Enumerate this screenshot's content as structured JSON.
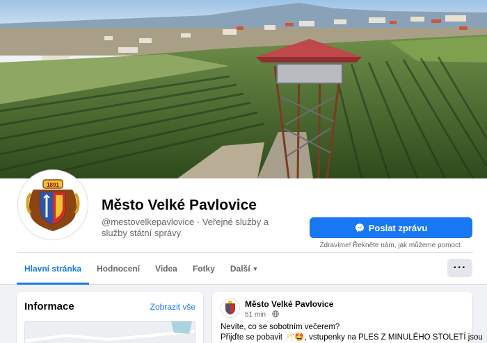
{
  "page": {
    "name": "Město Velké Pavlovice",
    "handle_category": "@mestovelkepavlovice · Veřejné služby a služby státní správy",
    "crest_year": "1891"
  },
  "actions": {
    "message_button": "Poslat zprávu",
    "message_hint": "Zdravíme! Řekněte nám, jak můžeme pomoct.",
    "more_icon": "ellipsis-icon"
  },
  "tabs": [
    {
      "label": "Hlavní stránka",
      "active": true
    },
    {
      "label": "Hodnocení"
    },
    {
      "label": "Videa"
    },
    {
      "label": "Fotky"
    },
    {
      "label": "Další",
      "caret": "▾"
    }
  ],
  "info": {
    "title": "Informace",
    "see_all": "Zobrazit vše"
  },
  "post": {
    "author": "Město Velké Pavlovice",
    "time": "51 min",
    "audience_icon": "globe-icon",
    "line1": "Nevíte, co se sobotním večerem?",
    "line2": "Přijďte se pobavit 🥂🤩, vstupenky na PLES Z MINULÉHO STOLETÍ jsou"
  },
  "colors": {
    "accent": "#1877f2",
    "secondary_text": "#65676b",
    "background": "#f0f2f5"
  }
}
